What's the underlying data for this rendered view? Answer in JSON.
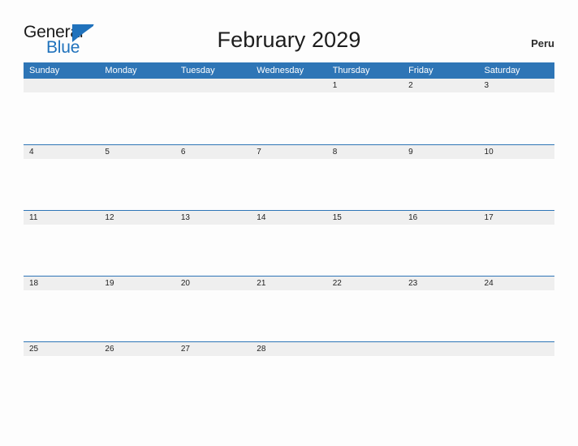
{
  "header": {
    "logo": {
      "word_one": "General",
      "word_two": "Blue",
      "flag_icon": "blue-triangle-flag-icon",
      "color_primary": "#1a1a1a",
      "color_accent": "#2072bc"
    },
    "title": "February 2029",
    "country": "Peru"
  },
  "calendar": {
    "month": "February",
    "year": "2029",
    "header_bg": "#2e75b6",
    "band_bg": "#efefef",
    "rule_color": "#2e75b6",
    "weekdays": [
      "Sunday",
      "Monday",
      "Tuesday",
      "Wednesday",
      "Thursday",
      "Friday",
      "Saturday"
    ],
    "weeks": [
      [
        "",
        "",
        "",
        "",
        "1",
        "2",
        "3"
      ],
      [
        "4",
        "5",
        "6",
        "7",
        "8",
        "9",
        "10"
      ],
      [
        "11",
        "12",
        "13",
        "14",
        "15",
        "16",
        "17"
      ],
      [
        "18",
        "19",
        "20",
        "21",
        "22",
        "23",
        "24"
      ],
      [
        "25",
        "26",
        "27",
        "28",
        "",
        "",
        ""
      ]
    ]
  }
}
